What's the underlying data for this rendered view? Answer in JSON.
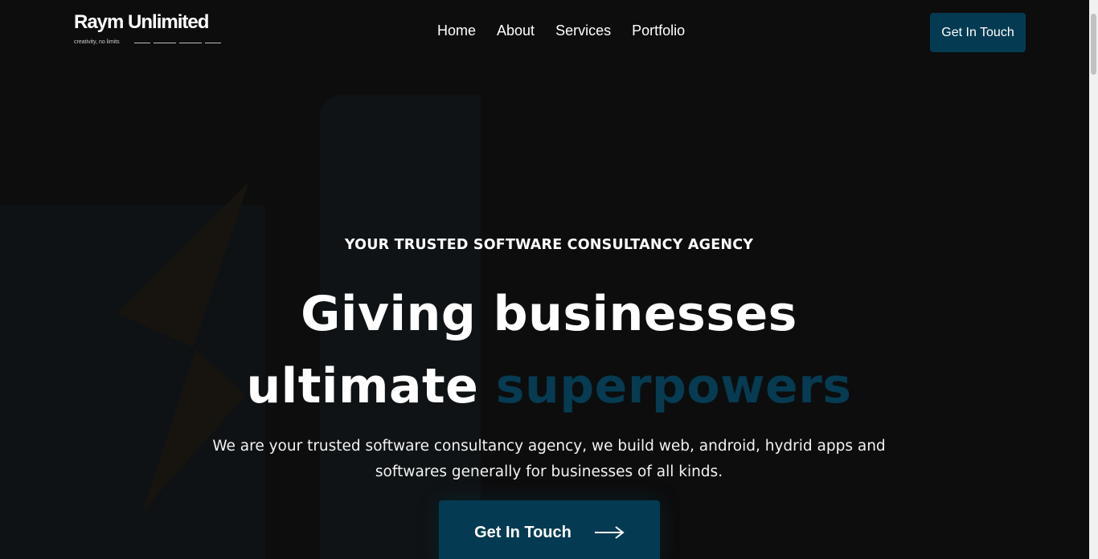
{
  "brand": {
    "name": "Raym Unlimited",
    "tagline": "creativity, no limits"
  },
  "nav": {
    "items": [
      {
        "label": "Home"
      },
      {
        "label": "About"
      },
      {
        "label": "Services"
      },
      {
        "label": "Portfolio"
      }
    ],
    "cta_label": "Get In Touch"
  },
  "hero": {
    "eyebrow": "YOUR TRUSTED SOFTWARE CONSULTANCY AGENCY",
    "headline_line1": "Giving businesses",
    "headline_line2_plain": "ultimate",
    "headline_line2_accent": "superpowers",
    "subtext": "We are your trusted software consultancy agency, we build web, android, hydrid apps and softwares generally for businesses of all kinds.",
    "cta_label": "Get In Touch",
    "cta_icon": "arrow-right-icon"
  },
  "colors": {
    "background": "#0d0d0e",
    "accent": "#053b52",
    "text": "#ffffff"
  }
}
